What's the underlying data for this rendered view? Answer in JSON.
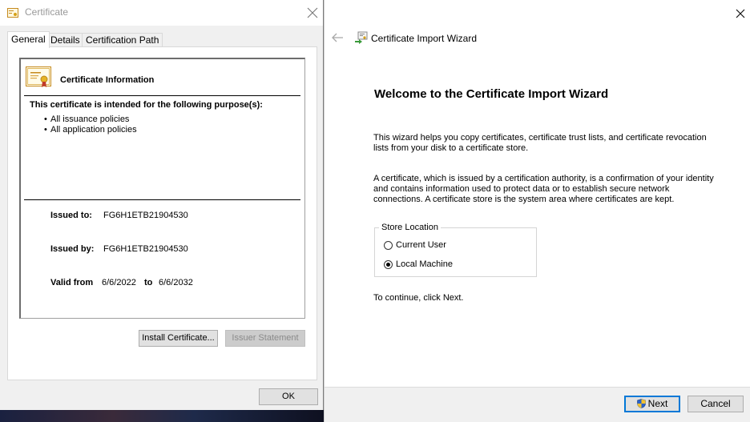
{
  "certificate_dialog": {
    "title": "Certificate",
    "tabs": [
      "General",
      "Details",
      "Certification Path"
    ],
    "info_heading": "Certificate Information",
    "purpose_heading": "This certificate is intended for the following purpose(s):",
    "purposes": [
      "All issuance policies",
      "All application policies"
    ],
    "issued_to_label": "Issued to:",
    "issued_to_value": "FG6H1ETB21904530",
    "issued_by_label": "Issued by:",
    "issued_by_value": "FG6H1ETB21904530",
    "valid_from_label": "Valid from",
    "valid_from_value": "6/6/2022",
    "valid_to_label": "to",
    "valid_to_value": "6/6/2032",
    "install_button": "Install Certificate...",
    "issuer_statement_button": "Issuer Statement",
    "ok_button": "OK"
  },
  "import_wizard": {
    "title": "Certificate Import Wizard",
    "heading": "Welcome to the Certificate Import Wizard",
    "para1": "This wizard helps you copy certificates, certificate trust lists, and certificate revocation lists from your disk to a certificate store.",
    "para2": "A certificate, which is issued by a certification authority, is a confirmation of your identity and contains information used to protect data or to establish secure network connections. A certificate store is the system area where certificates are kept.",
    "store_location_label": "Store Location",
    "options": [
      "Current User",
      "Local Machine"
    ],
    "selected_option": "Local Machine",
    "continue_text": "To continue, click Next.",
    "next_button": "Next",
    "cancel_button": "Cancel"
  },
  "colors": {
    "accent": "#0078d7",
    "window_bg": "#f0f0f0",
    "disabled_text": "#8a8a8a"
  },
  "icons": [
    "certificate-icon",
    "close-icon",
    "back-arrow-icon",
    "wizard-certificate-icon",
    "uac-shield-icon"
  ]
}
